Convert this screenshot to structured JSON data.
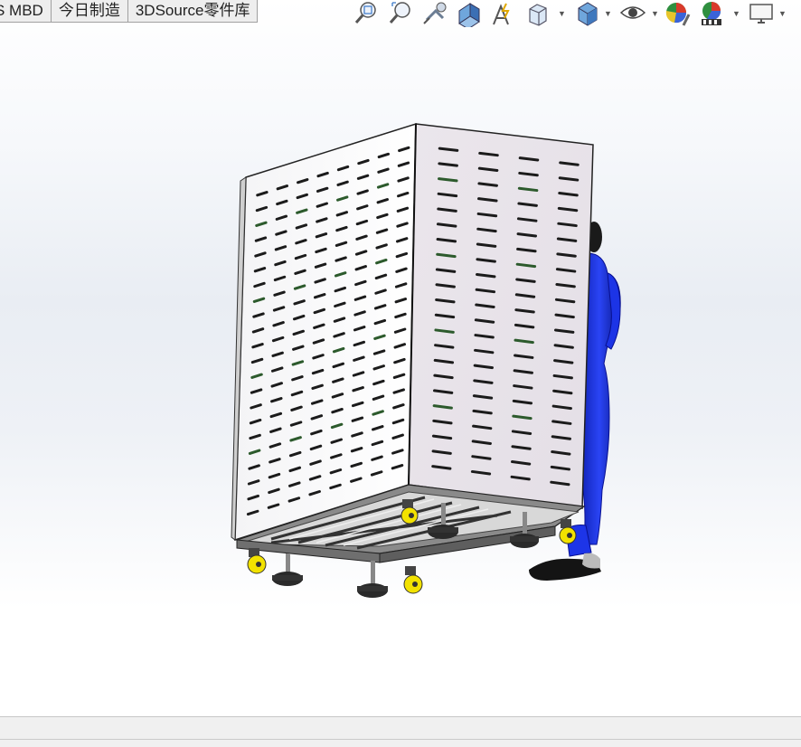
{
  "tabs": [
    {
      "label": "S MBD"
    },
    {
      "label": "今日制造"
    },
    {
      "label": "3DSource零件库"
    }
  ],
  "toolbar": {
    "icons": [
      "zoom-to-fit-icon",
      "zoom-to-area-icon",
      "previous-view-icon",
      "section-view-icon",
      "dynamic-annotation-icon",
      "view-orientation-icon",
      "display-style-icon",
      "hide-show-items-icon",
      "edit-appearance-icon",
      "apply-scene-icon",
      "view-settings-icon"
    ]
  },
  "colors": {
    "panel_face": "#e9e4ea",
    "human_figure": "#1a2fe0",
    "caster_wheel": "#f2e200",
    "leveling_foot": "#2a2a2a"
  }
}
